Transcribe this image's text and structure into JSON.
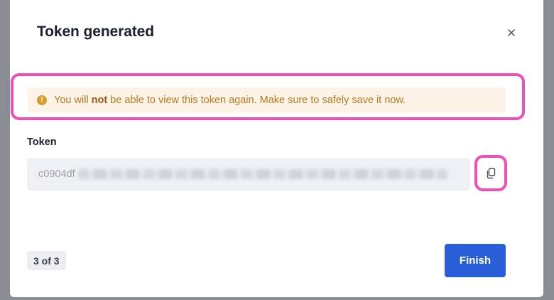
{
  "dialog": {
    "title": "Token generated",
    "close_icon": "close-icon"
  },
  "warning": {
    "icon": "exclamation-circle-icon",
    "icon_glyph": "!",
    "text_before": "You will ",
    "text_bold": "not",
    "text_after": " be able to view this token again. Make sure to safely save it now.",
    "color": "#b7791f",
    "background": "#fdf3e7"
  },
  "token": {
    "label": "Token",
    "value_visible": "c0904df",
    "copy_icon": "copy-icon"
  },
  "footer": {
    "step": "3 of 3",
    "finish_label": "Finish",
    "finish_color": "#2b5fd9"
  },
  "annotations": {
    "highlight_color": "#f04fb8"
  }
}
